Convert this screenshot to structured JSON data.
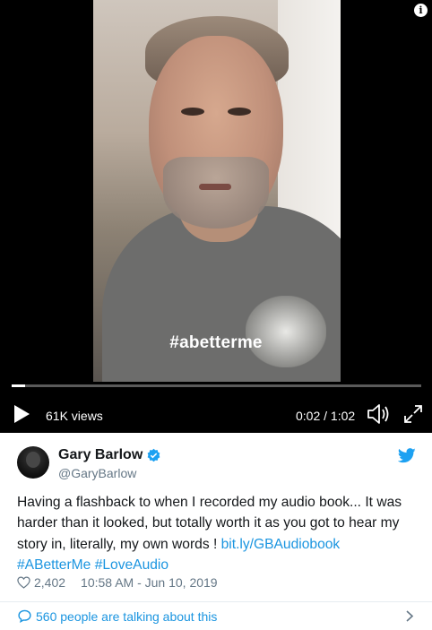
{
  "video": {
    "overlay_hashtag": "#abetterme",
    "views": "61K views",
    "time": "0:02 / 1:02",
    "progress_fraction": 0.032,
    "icons": [
      "info-icon",
      "play-icon",
      "volume-icon",
      "fullscreen-icon"
    ]
  },
  "tweet": {
    "name": "Gary Barlow",
    "handle": "@GaryBarlow",
    "text_main": "Having a flashback to when I recorded my audio book... It was harder than it looked, but totally worth it as you got to hear my story in, literally, my own words ! ",
    "link": "bit.ly/GBAudiobook",
    "hashtag1": "#ABetterMe",
    "hashtag2": "#LoveAudio",
    "likes": "2,402",
    "timestamp": "10:58 AM - Jun 10, 2019",
    "talking": "560 people are talking about this"
  },
  "colors": {
    "link_blue": "#1b95e0",
    "text": "#14171a",
    "secondary": "#657786",
    "video_bg": "#000000"
  }
}
